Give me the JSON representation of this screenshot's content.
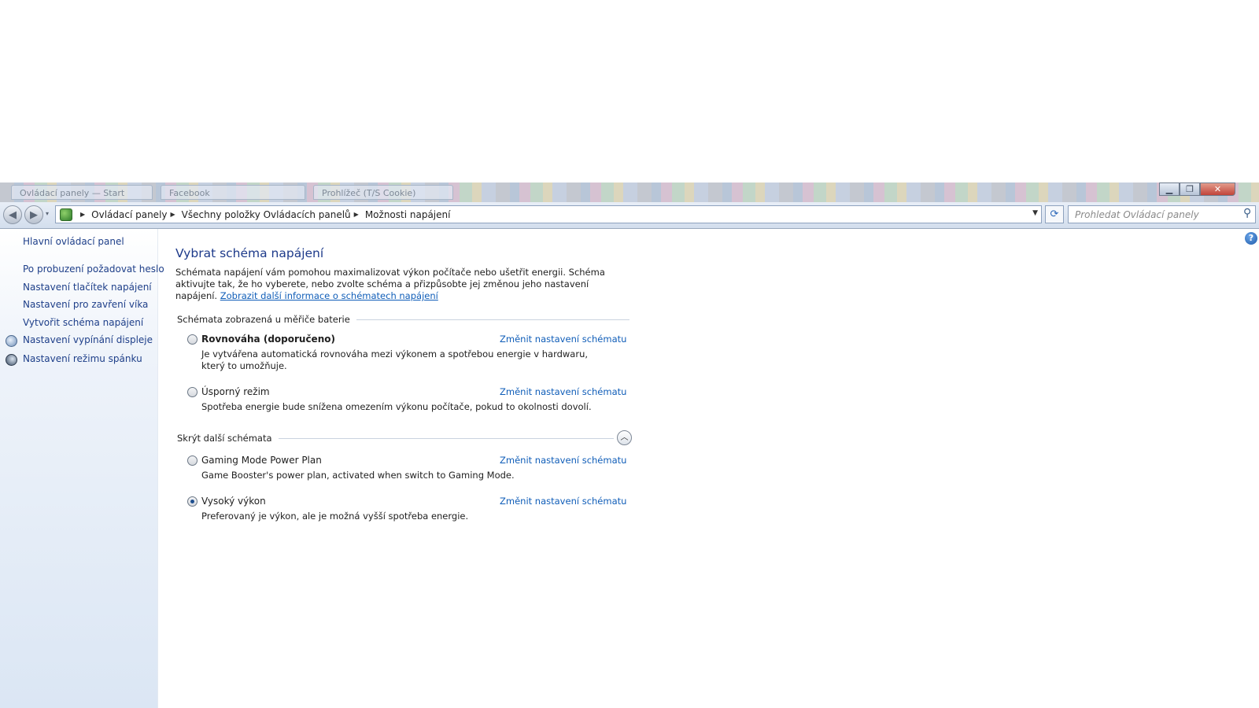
{
  "window": {
    "tabs": [
      {
        "label": "Ovládací panely — Start"
      },
      {
        "label": "Facebook"
      },
      {
        "label": "Prohlížeč (T/S Cookie)"
      }
    ],
    "controls": {
      "minimize": "▁",
      "maximize": "❐",
      "close": "✕"
    }
  },
  "address": {
    "back_icon": "◀",
    "forward_icon": "▶",
    "dropdown_icon": "▾",
    "separator": "▶",
    "crumbs": [
      "Ovládací panely",
      "Všechny položky Ovládacích panelů",
      "Možnosti napájení"
    ],
    "crumb_dropdown": "▼",
    "refresh_icon": "⟳",
    "search_placeholder": "Prohledat Ovládací panely",
    "search_icon": "⚲"
  },
  "sidebar": {
    "home_link": "Hlavní ovládací panel",
    "links": [
      "Po probuzení požadovat heslo",
      "Nastavení tlačítek napájení",
      "Nastavení pro zavření víka",
      "Vytvořit schéma napájení",
      "Nastavení vypínání displeje",
      "Nastavení režimu spánku"
    ]
  },
  "main": {
    "help_icon": "?",
    "title": "Vybrat schéma napájení",
    "intro_text": "Schémata napájení vám pomohou maximalizovat výkon počítače nebo ušetřit energii. Schéma aktivujte tak, že ho vyberete, nebo zvolte schéma a přizpůsobte jej změnou jeho nastavení napájení. ",
    "intro_link": "Zobrazit další informace o schématech napájení",
    "group_battery": "Schémata zobrazená u měřiče baterie",
    "group_more": "Skrýt další schémata",
    "collapse_icon": "︿",
    "plans": [
      {
        "name": "Rovnováha (doporučeno)",
        "link": "Změnit nastavení schématu",
        "desc": "Je vytvářena automatická rovnováha mezi výkonem a spotřebou energie v hardwaru, který to umožňuje."
      },
      {
        "name": "Úsporný režim",
        "link": "Změnit nastavení schématu",
        "desc": "Spotřeba energie bude snížena omezením výkonu počítače, pokud to okolnosti dovolí."
      },
      {
        "name": "Gaming Mode Power Plan",
        "link": "Změnit nastavení schématu",
        "desc": "Game Booster's power plan, activated when switch to Gaming Mode."
      },
      {
        "name": "Vysoký výkon",
        "link": "Změnit nastavení schématu",
        "desc": "Preferovaný je výkon, ale je možná vyšší spotřeba energie."
      }
    ]
  }
}
